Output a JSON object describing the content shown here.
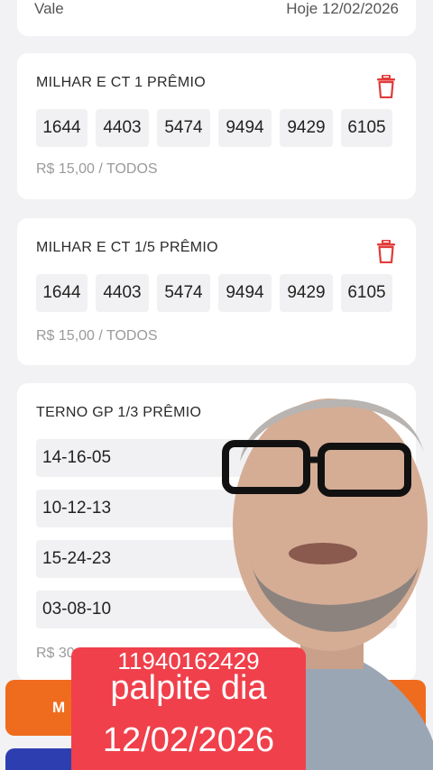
{
  "header_card": {
    "left_label": "Vale",
    "right_label": "Hoje 12/02/2026"
  },
  "bets": [
    {
      "title": "MILHAR E CT 1 PRÊMIO",
      "numbers": [
        "1644",
        "4403",
        "5474",
        "9494",
        "9429",
        "6105"
      ],
      "price": "R$ 15,00 / TODOS"
    },
    {
      "title": "MILHAR E CT 1/5 PRÊMIO",
      "numbers": [
        "1644",
        "4403",
        "5474",
        "9494",
        "9429",
        "6105"
      ],
      "price": "R$ 15,00 / TODOS"
    },
    {
      "title": "TERNO GP 1/3 PRÊMIO",
      "combos": [
        "14-16-05",
        "10-12-13",
        "15-24-23",
        "03-08-10"
      ],
      "price": "R$ 30"
    }
  ],
  "footer": {
    "primary_button_label": "M"
  },
  "overlay": {
    "phone": "11940162429",
    "line1": "palpite dia",
    "line2": "12/02/2026"
  },
  "colors": {
    "accent_red": "#e23b3b",
    "primary_orange": "#ef6c1e",
    "secondary_blue": "#2d3fb0",
    "overlay_red": "#f0404b"
  },
  "icons": {
    "delete": "trash-icon"
  }
}
